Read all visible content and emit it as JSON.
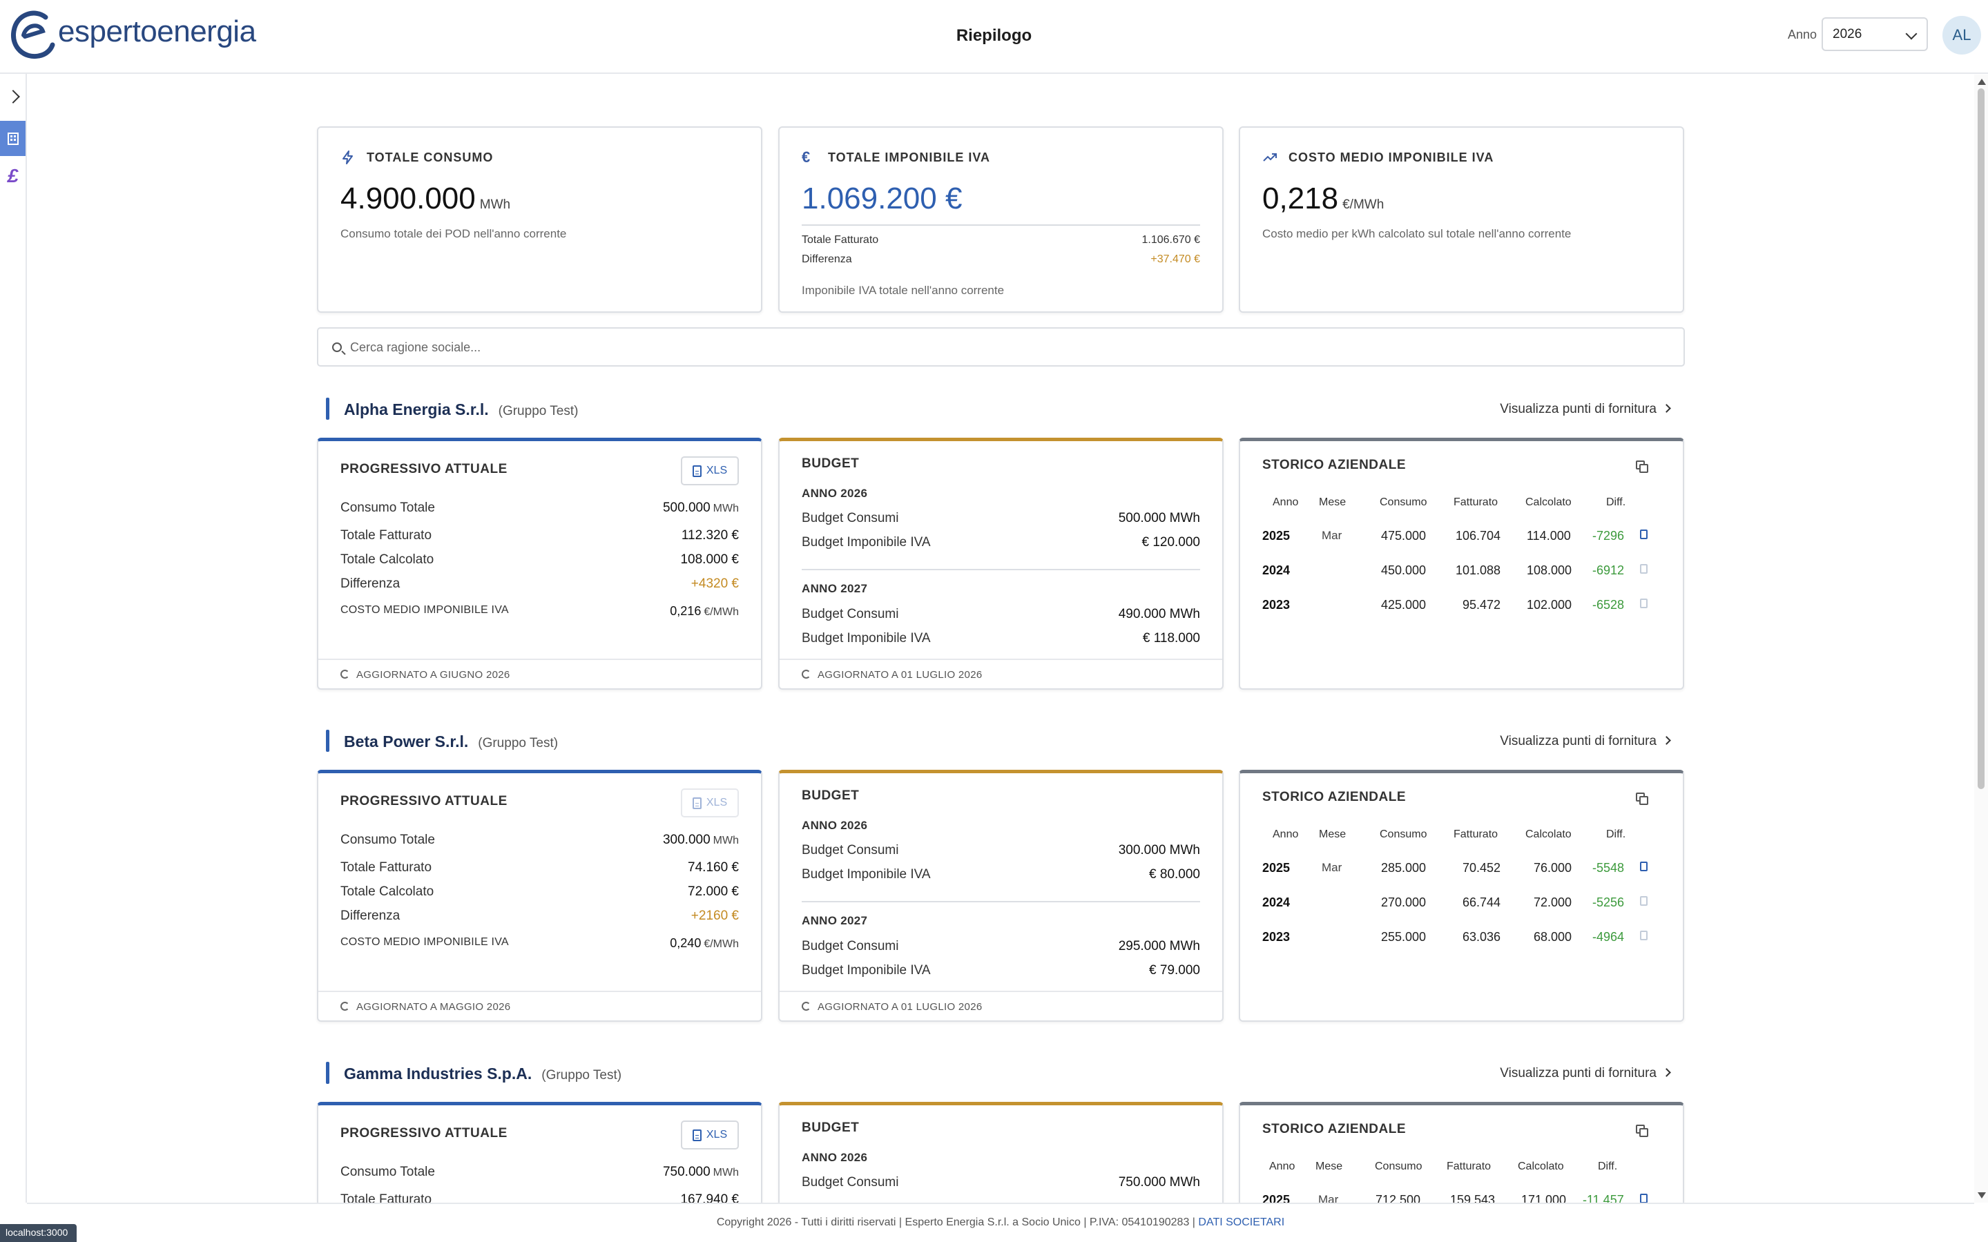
{
  "header": {
    "logo_text": "espertoenergia",
    "title": "Riepilogo",
    "year_label": "Anno",
    "year_value": "2026",
    "avatar_initials": "AL"
  },
  "kpis": {
    "consumo": {
      "title": "TOTALE CONSUMO",
      "icon": "lightning-icon",
      "value": "4.900.000",
      "unit": "MWh",
      "desc": "Consumo totale dei POD nell'anno corrente"
    },
    "imponibile": {
      "title": "TOTALE IMPONIBILE IVA",
      "icon": "euro-icon",
      "value": "1.069.200 €",
      "fatturato_label": "Totale Fatturato",
      "fatturato_value": "1.106.670 €",
      "diff_label": "Differenza",
      "diff_value": "+37.470 €",
      "desc": "Imponibile IVA totale nell'anno corrente"
    },
    "costo": {
      "title": "COSTO MEDIO IMPONIBILE IVA",
      "icon": "trending-up-icon",
      "value": "0,218",
      "unit": "€/MWh",
      "desc": "Costo medio per kWh calcolato sul totale nell'anno corrente"
    }
  },
  "search": {
    "placeholder": "Cerca ragione sociale..."
  },
  "labels": {
    "link": "Visualizza punti di fornitura",
    "prog_title": "PROGRESSIVO ATTUALE",
    "xls": "XLS",
    "consumo_totale": "Consumo Totale",
    "totale_fatturato": "Totale Fatturato",
    "totale_calcolato": "Totale Calcolato",
    "differenza": "Differenza",
    "costo_medio": "COSTO MEDIO IMPONIBILE IVA",
    "mwh": "MWh",
    "eur_mwh": "€/MWh",
    "budget_title": "BUDGET",
    "budget_consumi": "Budget Consumi",
    "budget_imponibile": "Budget Imponibile IVA",
    "storico_title": "STORICO AZIENDALE",
    "col_anno": "Anno",
    "col_mese": "Mese",
    "col_consumo": "Consumo",
    "col_fatturato": "Fatturato",
    "col_calcolato": "Calcolato",
    "col_diff": "Diff."
  },
  "companies": [
    {
      "name": "Alpha Energia S.r.l.",
      "group": "(Gruppo Test)",
      "prog": {
        "consumo": "500.000",
        "fatturato": "112.320 €",
        "calcolato": "108.000 €",
        "differenza": "+4320 €",
        "costo": "0,216",
        "updated": "AGGIORNATO A GIUGNO 2026"
      },
      "budget": [
        {
          "anno": "ANNO 2026",
          "consumi": "500.000 MWh",
          "imponibile": "€ 120.000"
        },
        {
          "anno": "ANNO 2027",
          "consumi": "490.000 MWh",
          "imponibile": "€ 118.000"
        }
      ],
      "budget_updated": "AGGIORNATO A 01 LUGLIO 2026",
      "storico": [
        {
          "anno": "2025",
          "mese": "Mar",
          "consumo": "475.000",
          "fatturato": "106.704",
          "calcolato": "114.000",
          "diff": "-7296"
        },
        {
          "anno": "2024",
          "mese": "",
          "consumo": "450.000",
          "fatturato": "101.088",
          "calcolato": "108.000",
          "diff": "-6912"
        },
        {
          "anno": "2023",
          "mese": "",
          "consumo": "425.000",
          "fatturato": "95.472",
          "calcolato": "102.000",
          "diff": "-6528"
        }
      ]
    },
    {
      "name": "Beta Power S.r.l.",
      "group": "(Gruppo Test)",
      "prog": {
        "consumo": "300.000",
        "fatturato": "74.160 €",
        "calcolato": "72.000 €",
        "differenza": "+2160 €",
        "costo": "0,240",
        "updated": "AGGIORNATO A MAGGIO 2026"
      },
      "budget": [
        {
          "anno": "ANNO 2026",
          "consumi": "300.000 MWh",
          "imponibile": "€ 80.000"
        },
        {
          "anno": "ANNO 2027",
          "consumi": "295.000 MWh",
          "imponibile": "€ 79.000"
        }
      ],
      "budget_updated": "AGGIORNATO A 01 LUGLIO 2026",
      "storico": [
        {
          "anno": "2025",
          "mese": "Mar",
          "consumo": "285.000",
          "fatturato": "70.452",
          "calcolato": "76.000",
          "diff": "-5548"
        },
        {
          "anno": "2024",
          "mese": "",
          "consumo": "270.000",
          "fatturato": "66.744",
          "calcolato": "72.000",
          "diff": "-5256"
        },
        {
          "anno": "2023",
          "mese": "",
          "consumo": "255.000",
          "fatturato": "63.036",
          "calcolato": "68.000",
          "diff": "-4964"
        }
      ]
    },
    {
      "name": "Gamma Industries S.p.A.",
      "group": "(Gruppo Test)",
      "prog": {
        "consumo": "750.000",
        "fatturato": "167.940 €"
      },
      "budget": [
        {
          "anno": "ANNO 2026",
          "consumi": "750.000 MWh"
        }
      ],
      "storico": [
        {
          "anno": "2025",
          "mese": "Mar",
          "consumo": "712.500",
          "fatturato": "159.543",
          "calcolato": "171.000",
          "diff": "-11.457"
        }
      ]
    }
  ],
  "footer": {
    "text": "Copyright 2026 - Tutti i diritti riservati | Esperto Energia S.r.l. a Socio Unico | P.IVA: 05410190283 |",
    "link": "DATI SOCIETARI"
  },
  "status_url": "localhost:3000"
}
